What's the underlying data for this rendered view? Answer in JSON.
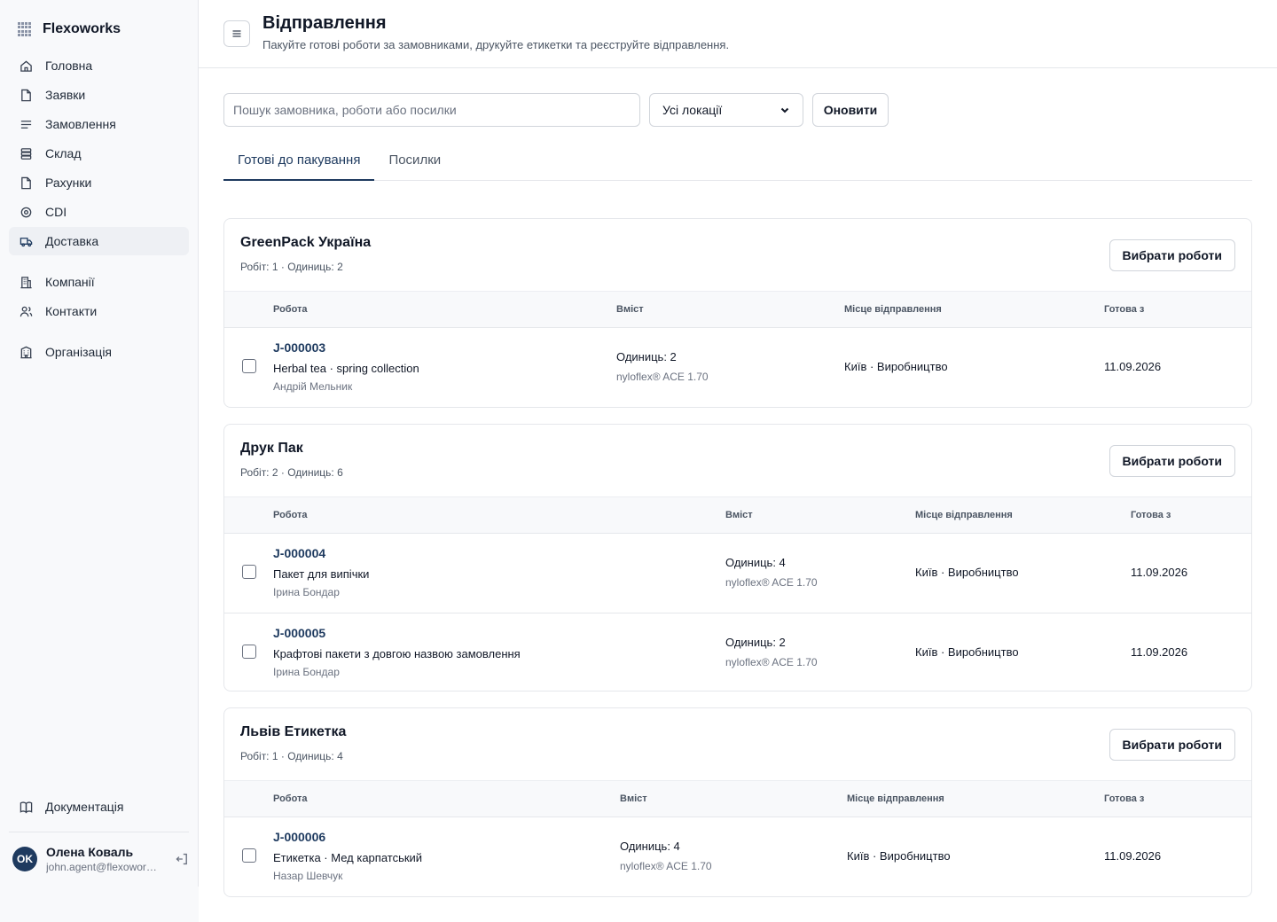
{
  "app": {
    "name": "Flexoworks"
  },
  "sidebar": {
    "nav_main": [
      {
        "label": "Головна",
        "icon": "home-icon"
      },
      {
        "label": "Заявки",
        "icon": "file-icon"
      },
      {
        "label": "Замовлення",
        "icon": "list-icon"
      },
      {
        "label": "Склад",
        "icon": "database-icon"
      },
      {
        "label": "Рахунки",
        "icon": "file-icon"
      },
      {
        "label": "CDI",
        "icon": "target-icon"
      },
      {
        "label": "Доставка",
        "icon": "truck-icon",
        "active": true
      }
    ],
    "nav_crm": [
      {
        "label": "Компанії",
        "icon": "building-icon"
      },
      {
        "label": "Контакти",
        "icon": "users-icon"
      }
    ],
    "nav_org": [
      {
        "label": "Організація",
        "icon": "building-icon"
      }
    ],
    "docs_label": "Документація",
    "user": {
      "initials": "OK",
      "name": "Олена Коваль",
      "email": "john.agent@flexoworks.com"
    }
  },
  "header": {
    "title": "Відправлення",
    "subtitle": "Пакуйте готові роботи за замовниками, друкуйте етикетки та реєструйте відправлення."
  },
  "toolbar": {
    "search_placeholder": "Пошук замовника, роботи або посилки",
    "location_selected": "Усі локації",
    "refresh_label": "Оновити"
  },
  "tabs": [
    {
      "label": "Готові до пакування",
      "active": true
    },
    {
      "label": "Посилки",
      "active": false
    }
  ],
  "columns": {
    "job": "Робота",
    "content": "Вміст",
    "location": "Місце відправлення",
    "ready": "Готова з"
  },
  "select_jobs_label": "Вибрати роботи",
  "groups": [
    {
      "customer": "GreenPack Україна",
      "meta": "Робіт: 1 · Одиниць: 2",
      "jobs": [
        {
          "id": "J-000003",
          "name": "Herbal tea · spring collection",
          "person": "Андрій Мельник",
          "units": "Одиниць: 2",
          "material": "nyloflex® ACE 1.70",
          "location": "Київ · Виробництво",
          "ready": "11.09.2026"
        }
      ]
    },
    {
      "customer": "Друк Пак",
      "meta": "Робіт: 2 · Одиниць: 6",
      "jobs": [
        {
          "id": "J-000004",
          "name": "Пакет для випічки",
          "person": "Ірина Бондар",
          "units": "Одиниць: 4",
          "material": "nyloflex® ACE 1.70",
          "location": "Київ · Виробництво",
          "ready": "11.09.2026"
        },
        {
          "id": "J-000005",
          "name": "Крафтові пакети з довгою назвою замовлення",
          "person": "Ірина Бондар",
          "units": "Одиниць: 2",
          "material": "nyloflex® ACE 1.70",
          "location": "Київ · Виробництво",
          "ready": "11.09.2026"
        }
      ]
    },
    {
      "customer": "Львів Етикетка",
      "meta": "Робіт: 1 · Одиниць: 4",
      "jobs": [
        {
          "id": "J-000006",
          "name": "Етикетка · Мед карпатський",
          "person": "Назар Шевчук",
          "units": "Одиниць: 4",
          "material": "nyloflex® ACE 1.70",
          "location": "Київ · Виробництво",
          "ready": "11.09.2026"
        }
      ]
    }
  ],
  "colors": {
    "accent": "#1e3a5f",
    "border": "#e5e7eb",
    "muted": "#6b7280"
  }
}
